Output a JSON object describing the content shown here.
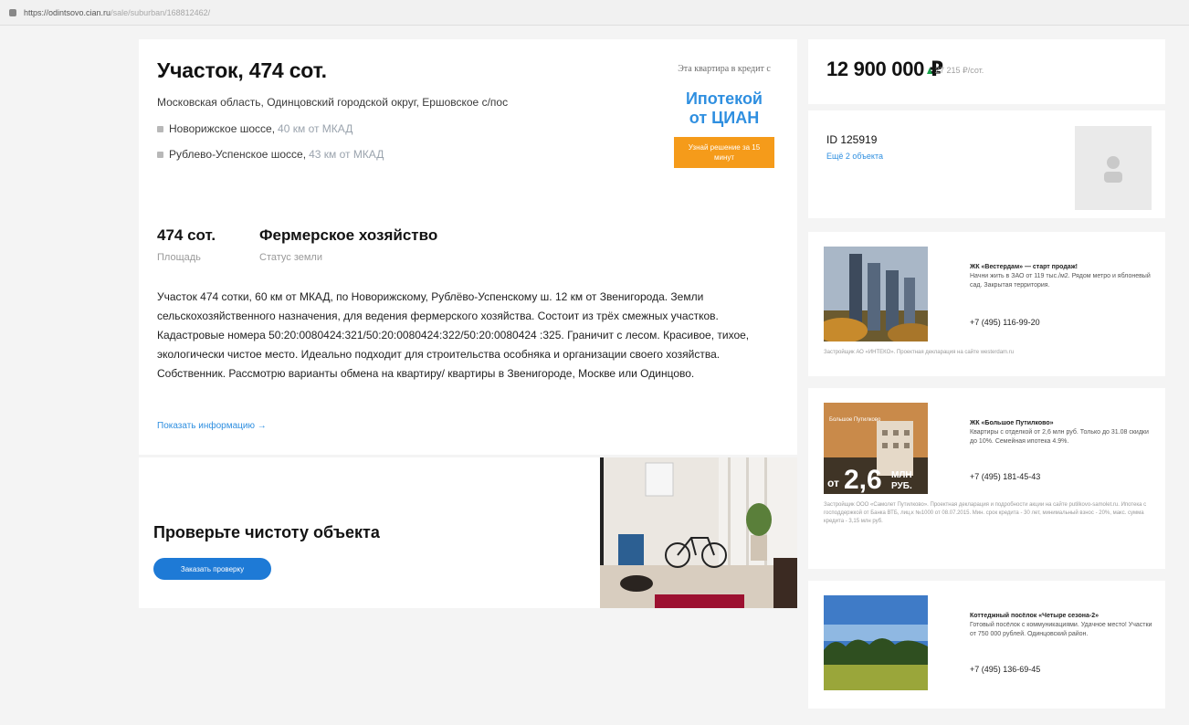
{
  "browser": {
    "url_host": "https://odintsovo.cian.ru",
    "url_path": "/sale/suburban/168812462/"
  },
  "listing": {
    "title": "Участок, 474 сот.",
    "address": "Московская область, Одинцовский городской округ, Ершовское с/пос",
    "highways": [
      {
        "name": "Новорижское шоссе,",
        "distance": "40 км от МКАД"
      },
      {
        "name": "Рублево-Успенское шоссе,",
        "distance": "43 км от МКАД"
      }
    ],
    "facts": [
      {
        "value": "474 сот.",
        "label": "Площадь"
      },
      {
        "value": "Фермерское хозяйство",
        "label": "Статус земли"
      }
    ],
    "description": "Участок 474 сотки, 60 км от МКАД, по Новорижскому, Рублёво-Успенскому ш. 12 км от Звенигорода. Земли сельскохозяйственного назначения, для ведения фермерского хозяйства. Состоит из трёх смежных участков. Кадастровые номера 50:20:0080424:321/50:20:0080424:322/50:20:0080424 :325. Граничит с лесом. Красивое, тихое, экологически чистое место. Идеально подходит для строительства особняка и организации своего хозяйства. Собственник. Рассмотрю варианты обмена на квартиру/ квартиры в Звенигороде, Москве или Одинцово.",
    "show_more": "Показать информацию →"
  },
  "mortgage_promo": {
    "lead": "Эта квартира в кредит с",
    "name_line1": "Ипотекой",
    "name_line2": "от ЦИАН",
    "button": "Узнай решение за 15 минут"
  },
  "check": {
    "title": "Проверьте чистоту объекта",
    "button": "Заказать проверку"
  },
  "price": {
    "value": "12 900 000 ₽",
    "per_unit": "27 215 ₽/сот."
  },
  "agent": {
    "id": "ID 125919",
    "more": "Ещё 2 объекта"
  },
  "ads": [
    {
      "title": "ЖК «Вестердам» — старт продаж!",
      "text": "Начни жить в ЗАО от 119 тыс./м2. Рядом метро и яблоневый сад. Закрытая территория.",
      "phone": "+7 (495) 116-99-20",
      "legal": "Застройщик АО «ИНТЕКО». Проектная декларация на сайте westerdam.ru"
    },
    {
      "title": "ЖК «Большое Путилково»",
      "text": "Квартиры с отделкой от 2,6 млн руб. Только до 31.08 скидки до 10%. Семейная ипотека 4.9%.",
      "phone": "+7 (495) 181-45-43",
      "legal": "Застройщик ООО «Самолет Путилково». Проектная декларация и подробности акции на сайте putilkovo-samolet.ru. Ипотека с господдержкой от Банка ВТБ, лиц.к №1000 от 08.07.2015. Мин. срок кредита - 30 лет, минимальный взнос - 20%, макс. сумма кредита - 3,15 млн руб.",
      "banner_tag": "Большое Путилково",
      "banner_from": "от",
      "banner_value": "2,6",
      "banner_unit1": "МЛН",
      "banner_unit2": "РУБ."
    },
    {
      "title": "Коттеджный посёлок «Четыре сезона-2»",
      "text": "Готовый посёлок с коммуникациями. Удачное место! Участки от 750 000 рублей. Одинцовский район.",
      "phone": "+7 (495) 136-69-45"
    }
  ]
}
